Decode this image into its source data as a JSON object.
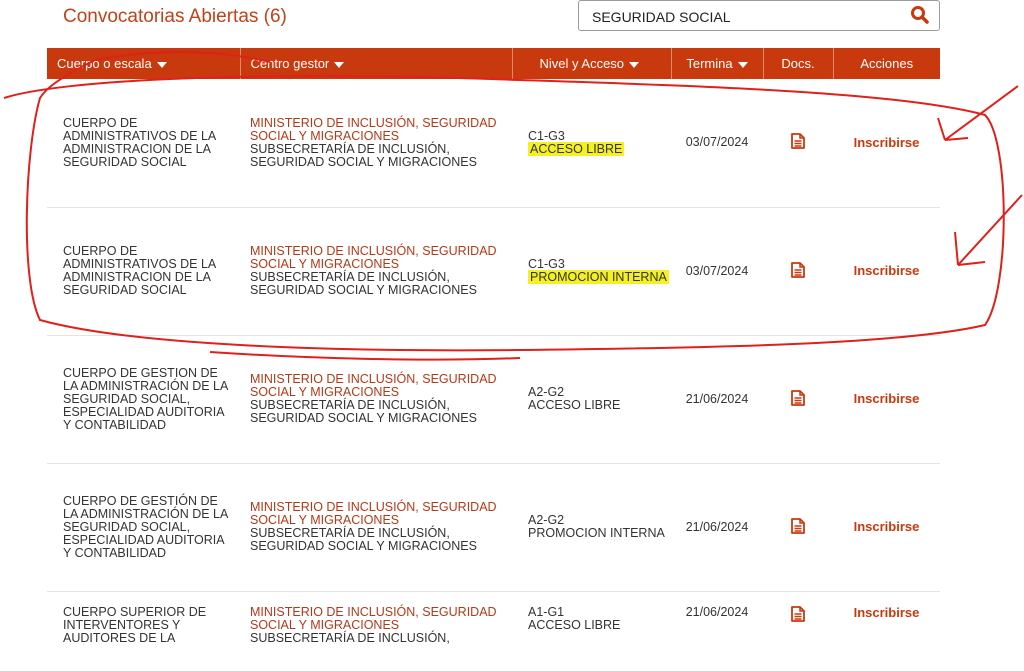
{
  "page_title": "Convocatorias Abiertas (6)",
  "search": {
    "value": "SEGURIDAD SOCIAL",
    "icon": "search-icon"
  },
  "columns": {
    "cuerpo": "Cuerpo o escala",
    "centro": "Centro gestor",
    "nivel": "Nivel y Acceso",
    "termina": "Termina",
    "docs": "Docs.",
    "acciones": "Acciones"
  },
  "rows": [
    {
      "cuerpo": "CUERPO DE ADMINISTRATIVOS DE LA ADMINISTRACION DE LA SEGURIDAD SOCIAL",
      "ministerio": "MINISTERIO DE INCLUSIÓN, SEGURIDAD SOCIAL Y MIGRACIONES",
      "subsecretaria": "SUBSECRETARÍA DE INCLUSIÓN, SEGURIDAD SOCIAL Y MIGRACIONES",
      "nivel": "C1-G3",
      "acceso": "ACCESO LIBRE",
      "termina": "03/07/2024",
      "accion": "Inscribirse"
    },
    {
      "cuerpo": "CUERPO DE ADMINISTRATIVOS DE LA ADMINISTRACION DE LA SEGURIDAD SOCIAL",
      "ministerio": "MINISTERIO DE INCLUSIÓN, SEGURIDAD SOCIAL Y MIGRACIONES",
      "subsecretaria": "SUBSECRETARÍA DE INCLUSIÓN, SEGURIDAD SOCIAL Y MIGRACIONES",
      "nivel": "C1-G3",
      "acceso": "PROMOCION INTERNA",
      "termina": "03/07/2024",
      "accion": "Inscribirse"
    },
    {
      "cuerpo": "CUERPO DE GESTION DE LA ADMINISTRACIÓN DE LA SEGURIDAD SOCIAL, ESPECIALIDAD AUDITORIA Y CONTABILIDAD",
      "ministerio": "MINISTERIO DE INCLUSIÓN, SEGURIDAD SOCIAL Y MIGRACIONES",
      "subsecretaria": "SUBSECRETARÍA DE INCLUSIÓN, SEGURIDAD SOCIAL Y MIGRACIONES",
      "nivel": "A2-G2",
      "acceso": "ACCESO LIBRE",
      "termina": "21/06/2024",
      "accion": "Inscribirse"
    },
    {
      "cuerpo": "CUERPO DE GESTIÓN DE LA ADMINISTRACIÓN DE LA SEGURIDAD SOCIAL, ESPECIALIDAD AUDITORIA Y CONTABILIDAD",
      "ministerio": "MINISTERIO DE INCLUSIÓN, SEGURIDAD SOCIAL Y MIGRACIONES",
      "subsecretaria": "SUBSECRETARÍA DE INCLUSIÓN, SEGURIDAD SOCIAL Y MIGRACIONES",
      "nivel": "A2-G2",
      "acceso": "PROMOCION INTERNA",
      "termina": "21/06/2024",
      "accion": "Inscribirse"
    },
    {
      "cuerpo": "CUERPO SUPERIOR DE INTERVENTORES Y AUDITORES DE LA",
      "ministerio": "MINISTERIO DE INCLUSIÓN, SEGURIDAD SOCIAL Y MIGRACIONES",
      "subsecretaria": "SUBSECRETARÍA DE INCLUSIÓN,",
      "nivel": "A1-G1",
      "acceso": "ACCESO LIBRE",
      "termina": "21/06/2024",
      "accion": "Inscribirse"
    }
  ],
  "colors": {
    "brand": "#c9390e",
    "title": "#c0421a",
    "ministry_text": "#b3391a",
    "highlight": "#f6f022",
    "annotation": "#e0201a"
  }
}
